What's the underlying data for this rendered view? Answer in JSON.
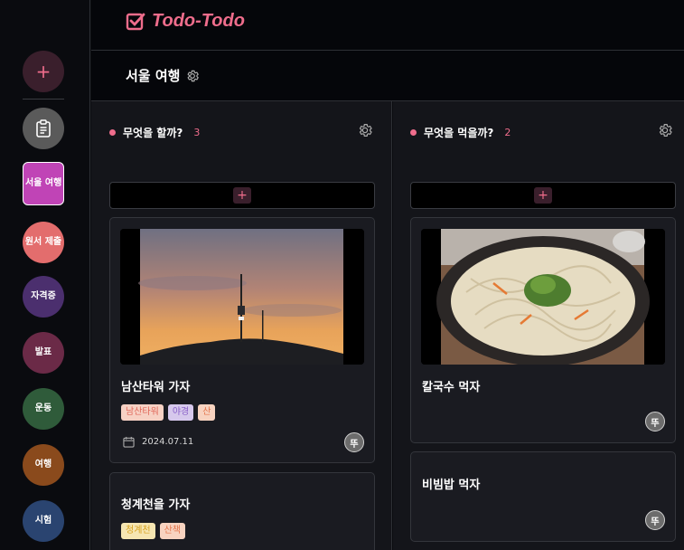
{
  "app": {
    "name": "Todo-Todo"
  },
  "sidebar": {
    "add_label": "+",
    "boards": [
      {
        "label": "서울 여행",
        "color": "#c044b6"
      },
      {
        "label": "원서 제출",
        "color": "#e36d6d"
      },
      {
        "label": "자격증",
        "color": "#4b2f6e"
      },
      {
        "label": "발표",
        "color": "#6b2a47"
      },
      {
        "label": "운동",
        "color": "#2f5b3a"
      },
      {
        "label": "여행",
        "color": "#8a4a1c"
      },
      {
        "label": "시험",
        "color": "#2a4470"
      }
    ]
  },
  "board": {
    "title": "서울 여행"
  },
  "columns": [
    {
      "title": "무엇을 할까?",
      "count": "3",
      "add_label": "+",
      "cards": [
        {
          "title": "남산타워 가자",
          "tags": [
            {
              "label": "남산타워",
              "bg": "#f7d1c4",
              "fg": "#e0685a"
            },
            {
              "label": "야경",
              "bg": "#d6c8ec",
              "fg": "#8a62c8"
            },
            {
              "label": "산",
              "bg": "#f8d3c0",
              "fg": "#e3744a"
            }
          ],
          "date": "2024.07.11",
          "assignee": "뚜"
        },
        {
          "title": "청계천을 가자",
          "tags": [
            {
              "label": "청계천",
              "bg": "#f6e6b2",
              "fg": "#d7a21e"
            },
            {
              "label": "산책",
              "bg": "#f8d3c0",
              "fg": "#e3744a"
            }
          ]
        }
      ]
    },
    {
      "title": "무엇을 먹을까?",
      "count": "2",
      "add_label": "+",
      "cards": [
        {
          "title": "칼국수 먹자",
          "assignee": "뚜"
        },
        {
          "title": "비빔밥 먹자",
          "assignee": "뚜"
        }
      ]
    }
  ],
  "icons": {
    "logo": "checkbox-icon",
    "board_settings": "gear-icon",
    "board_list": "clipboard-icon",
    "calendar": "calendar-icon"
  }
}
